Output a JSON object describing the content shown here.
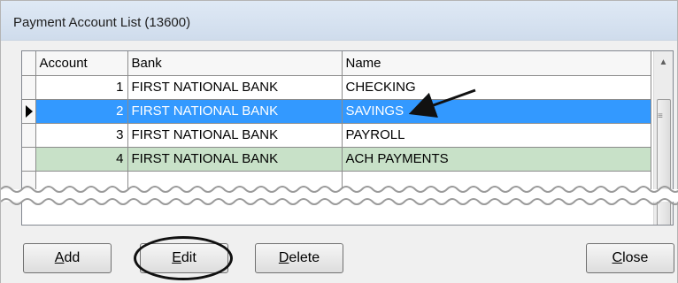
{
  "window": {
    "title": "Payment Account List (13600)"
  },
  "table": {
    "columns": [
      "Account",
      "Bank",
      "Name"
    ],
    "rows": [
      {
        "account": "1",
        "bank": "FIRST NATIONAL BANK",
        "name": "CHECKING"
      },
      {
        "account": "2",
        "bank": "FIRST NATIONAL BANK",
        "name": "SAVINGS"
      },
      {
        "account": "3",
        "bank": "FIRST NATIONAL BANK",
        "name": "PAYROLL"
      },
      {
        "account": "4",
        "bank": "FIRST NATIONAL BANK",
        "name": "ACH PAYMENTS"
      }
    ],
    "selected_row": 2
  },
  "buttons": {
    "add": {
      "label": "Add",
      "mnemonic": "A",
      "rest": "dd"
    },
    "edit": {
      "label": "Edit",
      "mnemonic": "E",
      "rest": "dit"
    },
    "delete": {
      "label": "Delete",
      "mnemonic": "D",
      "rest": "elete"
    },
    "close": {
      "label": "Close",
      "mnemonic": "C",
      "rest": "lose"
    }
  },
  "colors": {
    "selection": "#3399ff",
    "highlight_row": "#c8e1c8",
    "annotation": "#111111"
  }
}
